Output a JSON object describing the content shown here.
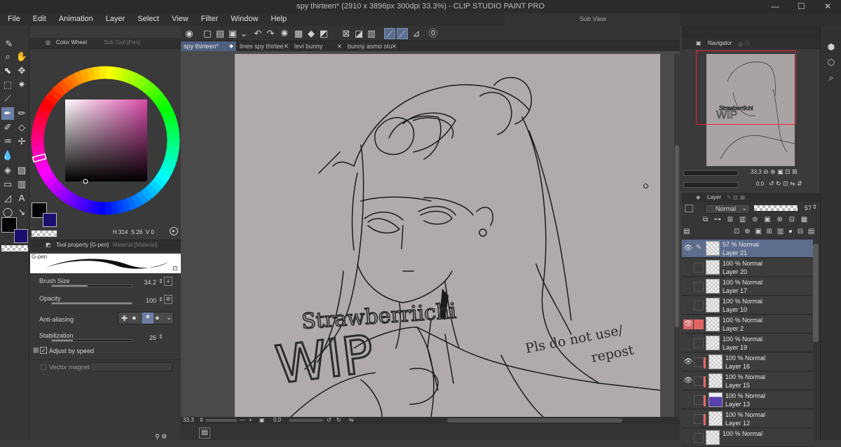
{
  "window": {
    "title": "spy thirteen* (2910 x 3896px 300dpi 33.3%)  - CLIP STUDIO PAINT PRO",
    "controls": {
      "minimize": "—",
      "maximize": "☐",
      "close": "✕"
    }
  },
  "menu": [
    "File",
    "Edit",
    "Animation",
    "Layer",
    "Select",
    "View",
    "Filter",
    "Window",
    "Help"
  ],
  "subview": {
    "title": "Sub View"
  },
  "color_panel": {
    "tab_active": "Color Wheel",
    "tab_inactive": "Sub Tool [Pen]",
    "readout_h": "H",
    "readout_h_val": "314",
    "readout_s": "S",
    "readout_s_val": "26",
    "readout_v": "V",
    "readout_v_val": "0",
    "main_color": "#050508",
    "sub_color": "#1a0e6e",
    "hue_marker_color": "#d94aa8"
  },
  "tool_property": {
    "tab_active": "Tool property [G-pen]",
    "tab_inactive": "Material [Material]",
    "brush_name": "G-pen",
    "brush_size_label": "Brush Size",
    "brush_size_val": "34.2",
    "brush_size_fraction": 0.45,
    "opacity_label": "Opacity",
    "opacity_val": "100",
    "opacity_fraction": 1.0,
    "anti_aliasing_label": "Anti-aliasing",
    "stabilization_label": "Stabilization",
    "stabilization_val": "26",
    "stabilization_fraction": 0.26,
    "adjust_by_speed_label": "Adjust by speed",
    "vector_magnet_label": "Vector magnet"
  },
  "doc_tabs": [
    {
      "label": "spy thirteen*",
      "active": true
    },
    {
      "label": "lines spy thirtee"
    },
    {
      "label": "levi bunny"
    },
    {
      "label": "bunny asmo stu"
    }
  ],
  "canvas": {
    "text_strawberry": "Strawberriichi",
    "text_wip": "WIP",
    "text_pls": "Pls do not use/",
    "text_repost": "repost"
  },
  "status": {
    "zoom": "33.3",
    "angle": "0.0"
  },
  "navigator": {
    "title": "Navigator",
    "zoom": "33.3",
    "rotation": "0.0"
  },
  "layer_panel": {
    "title": "Layer",
    "blend_mode": "Normal",
    "opacity": "57",
    "layers": [
      {
        "mode": "57 % Normal",
        "name": "Layer 21",
        "selected": true,
        "eye": true,
        "pen": true
      },
      {
        "mode": "100 % Normal",
        "name": "Layer 20"
      },
      {
        "mode": "100 % Normal",
        "name": "Layer 17"
      },
      {
        "mode": "100 % Normal",
        "name": "Layer 10"
      },
      {
        "mode": "100 % Normal",
        "name": "Layer 2",
        "red": true,
        "eye": true
      },
      {
        "mode": "100 % Normal",
        "name": "Layer 19"
      },
      {
        "mode": "100 % Normal",
        "name": "Layer 16",
        "eye": true,
        "pink": true
      },
      {
        "mode": "100 % Normal",
        "name": "Layer 15",
        "eye": true,
        "pink": true
      },
      {
        "mode": "100 % Normal",
        "name": "Layer 13",
        "pink": true,
        "purple": true
      },
      {
        "mode": "100 % Normal",
        "name": "Layer 12",
        "pink": true
      },
      {
        "mode": "100 % Normal",
        "name": ""
      }
    ]
  }
}
